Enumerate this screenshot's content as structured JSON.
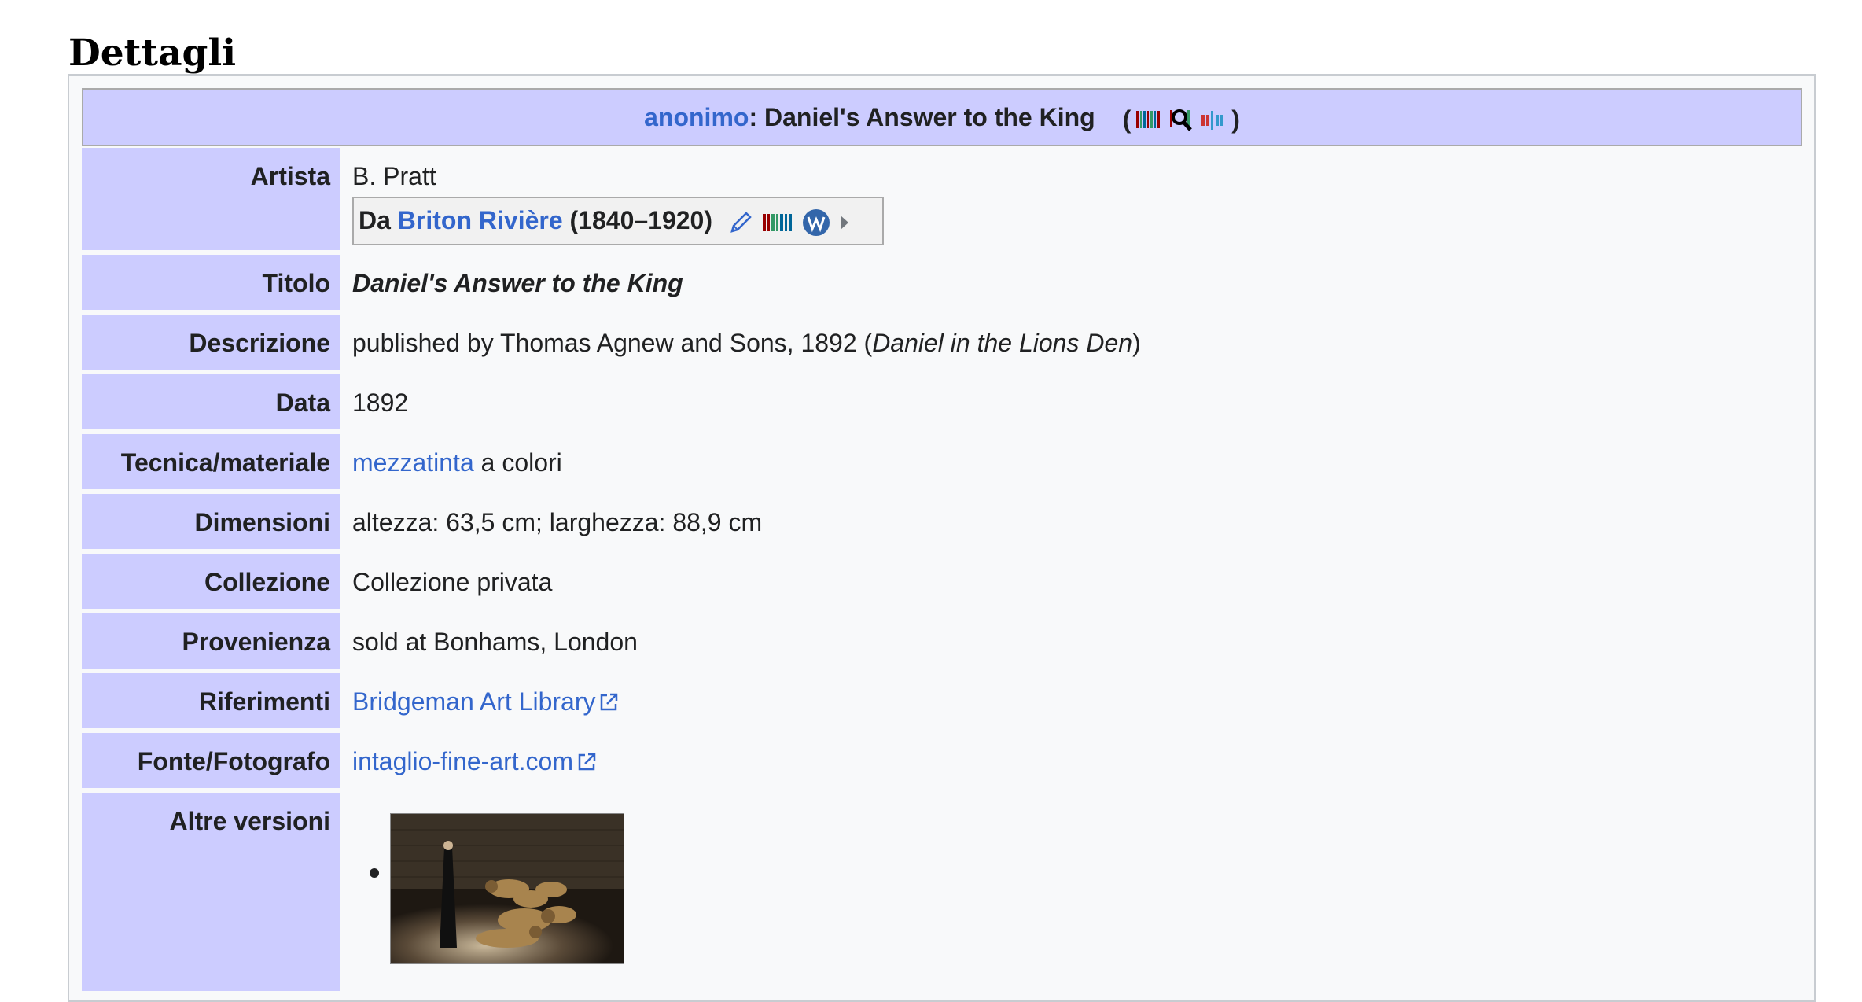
{
  "heading": "Dettagli",
  "title_bar": {
    "author_link": "anonimo",
    "separator": ":",
    "work_title": "Daniel's Answer to the King",
    "icons_open": "(",
    "icons_close": ")",
    "icons": [
      "wikidata-barcode-icon",
      "search-magnifier-icon",
      "wikidata-edit-icon"
    ]
  },
  "rows": {
    "artista": {
      "label": "Artista",
      "value": "B. Pratt",
      "creator": {
        "prefix": "Da",
        "name_link": "Briton Rivière",
        "dates": "(1840–1920)"
      }
    },
    "titolo": {
      "label": "Titolo",
      "value": "Daniel's Answer to the King"
    },
    "descrizione": {
      "label": "Descrizione",
      "value_plain": "published by Thomas Agnew and Sons, 1892 (",
      "value_italic": "Daniel in the Lions Den",
      "value_close": ")"
    },
    "data": {
      "label": "Data",
      "value": "1892"
    },
    "tecnica": {
      "label": "Tecnica/materiale",
      "link": "mezzatinta",
      "rest": " a colori"
    },
    "dimensioni": {
      "label": "Dimensioni",
      "value": "altezza: 63,5 cm; larghezza: 88,9 cm"
    },
    "collezione": {
      "label": "Collezione",
      "value": "Collezione privata"
    },
    "provenienza": {
      "label": "Provenienza",
      "value": "sold at Bonhams, London"
    },
    "riferimenti": {
      "label": "Riferimenti",
      "link": "Bridgeman Art Library"
    },
    "fonte": {
      "label": "Fonte/Fotografo",
      "link": "intaglio-fine-art.com"
    },
    "altre": {
      "label": "Altre versioni"
    }
  },
  "colors": {
    "label_bg": "#ccccff",
    "link": "#3366cc",
    "box_bg": "#f8f9fa"
  }
}
